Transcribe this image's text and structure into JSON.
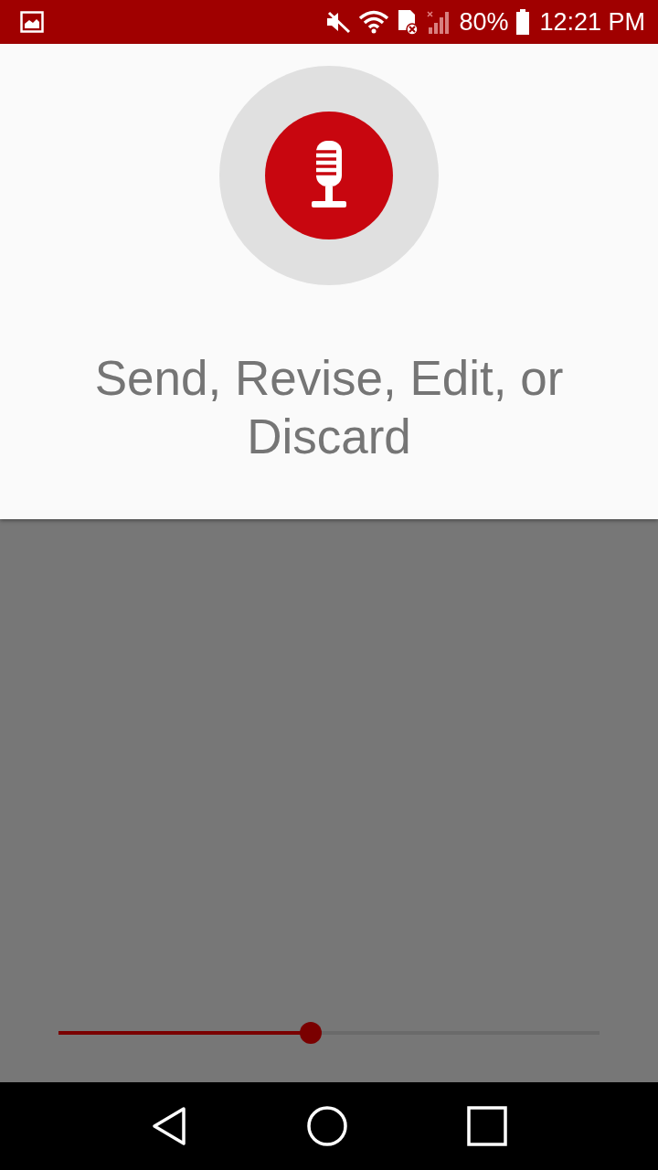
{
  "status_bar": {
    "battery": "80%",
    "time": "12:21 PM"
  },
  "prompt": "Send, Revise, Edit, or Discard",
  "slider": {
    "level": 0.466
  }
}
